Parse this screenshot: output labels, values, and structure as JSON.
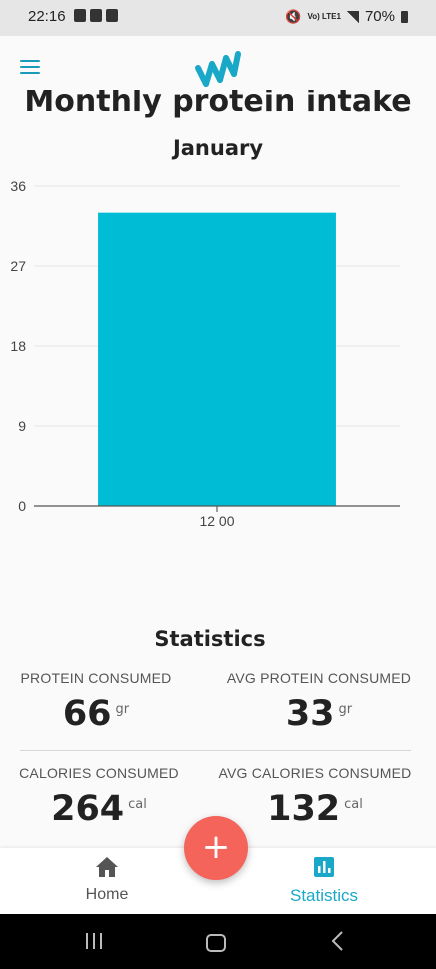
{
  "status_bar": {
    "time": "22:16",
    "lte": "Vo) LTE1",
    "battery": "70%"
  },
  "header": {
    "menu_icon": "hamburger-icon",
    "logo_icon": "app-logo-icon"
  },
  "page": {
    "title": "Monthly protein intake"
  },
  "chart_data": {
    "type": "bar",
    "title": "January",
    "categories": [
      "12 00"
    ],
    "values": [
      33
    ],
    "ylim": [
      0,
      36
    ],
    "yticks": [
      0,
      9,
      18,
      27,
      36
    ],
    "bar_color": "#00bcd4",
    "grid": true,
    "xlabel": "",
    "ylabel": ""
  },
  "statistics": {
    "title": "Statistics",
    "items": [
      {
        "label": "PROTEIN CONSUMED",
        "value": "66",
        "unit": "gr"
      },
      {
        "label": "AVG PROTEIN CONSUMED",
        "value": "33",
        "unit": "gr"
      },
      {
        "label": "CALORIES CONSUMED",
        "value": "264",
        "unit": "cal"
      },
      {
        "label": "AVG CALORIES CONSUMED",
        "value": "132",
        "unit": "cal"
      }
    ]
  },
  "fab": {
    "label": "+"
  },
  "bottom_nav": {
    "home_label": "Home",
    "statistics_label": "Statistics",
    "active": "Statistics",
    "active_color": "#1aa8c8"
  },
  "colors": {
    "accent": "#1a9bbb",
    "fab": "#f4645a"
  }
}
